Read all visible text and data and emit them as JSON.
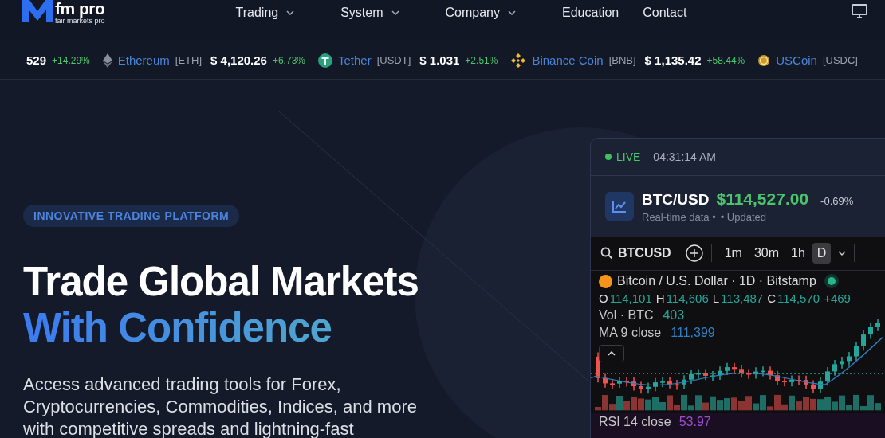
{
  "logo": {
    "brand": "fm pro",
    "tagline": "fair markets pro"
  },
  "nav": [
    {
      "label": "Trading",
      "dropdown": true
    },
    {
      "label": "System",
      "dropdown": true
    },
    {
      "label": "Company",
      "dropdown": true
    },
    {
      "label": "Education",
      "dropdown": false
    },
    {
      "label": "Contact",
      "dropdown": false
    }
  ],
  "ticker": [
    {
      "kind": "partial",
      "price": "529",
      "change": "+14.29%"
    },
    {
      "kind": "eth",
      "name": "Ethereum",
      "symbol": "[ETH]",
      "price": "$ 4,120.26",
      "change": "+6.73%"
    },
    {
      "kind": "usdt",
      "name": "Tether",
      "symbol": "[USDT]",
      "price": "$ 1.031",
      "change": "+2.51%"
    },
    {
      "kind": "bnb",
      "name": "Binance Coin",
      "symbol": "[BNB]",
      "price": "$ 1,135.42",
      "change": "+58.44%"
    },
    {
      "kind": "usdc",
      "name": "USCoin",
      "symbol": "[USDC]"
    }
  ],
  "hero": {
    "badge": "INNOVATIVE TRADING PLATFORM",
    "title": "Trade Global Markets",
    "title_accent": "With Confidence",
    "lines": [
      "Access advanced trading tools for Forex,",
      "Cryptocurrencies, Commodities, Indices, and more",
      "with competitive spreads and lightning-fast"
    ]
  },
  "widget": {
    "live": "LIVE",
    "time": "04:31:14 AM",
    "pair": "BTC/USD",
    "price": "$114,527.00",
    "change": "-0.69%",
    "sub": "Real-time data •",
    "updated": "• Updated",
    "symbol": "BTCUSD",
    "timeframes": [
      {
        "label": "1m",
        "selected": false
      },
      {
        "label": "30m",
        "selected": false
      },
      {
        "label": "1h",
        "selected": false
      },
      {
        "label": "D",
        "selected": true
      }
    ],
    "legend_title": "Bitcoin / U.S. Dollar · 1D · Bitstamp",
    "ohlc": [
      {
        "key": "O",
        "value": "114,101"
      },
      {
        "key": "H",
        "value": "114,606"
      },
      {
        "key": "L",
        "value": "113,487"
      },
      {
        "key": "C",
        "value": "114,570"
      }
    ],
    "ohlc_change": "+469",
    "indicators": [
      {
        "name": "Vol · BTC",
        "value": "403",
        "color": "#26a69a"
      },
      {
        "name": "MA 9 close",
        "value": "111,399",
        "color": "#2f7fc1"
      }
    ],
    "rsi": {
      "name": "RSI 14 close",
      "value": "53.97"
    }
  }
}
